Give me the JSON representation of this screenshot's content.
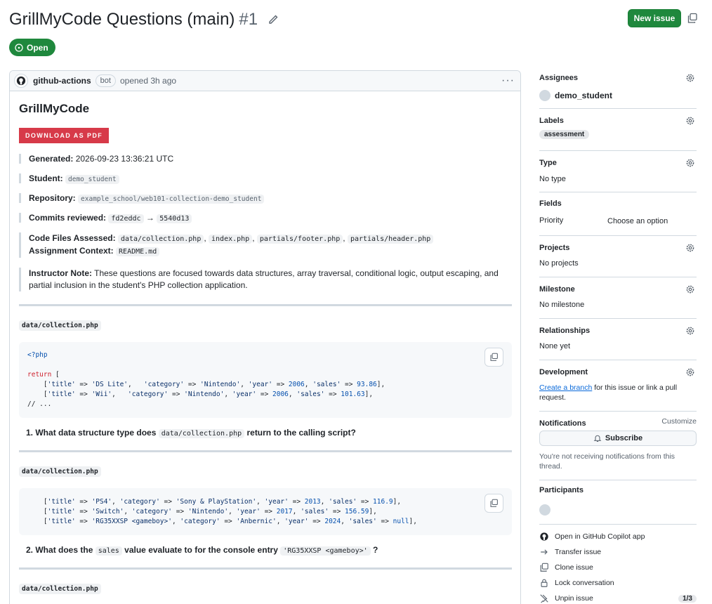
{
  "header": {
    "title": "GrillMyCode Questions (main)",
    "number": "#1",
    "new_issue_label": "New issue",
    "state": "Open"
  },
  "comment": {
    "author": "github-actions",
    "author_badge": "bot",
    "meta": "opened 3h ago",
    "heading": "GrillMyCode",
    "pdf_button": "DOWNLOAD AS PDF",
    "generated_label": "Generated:",
    "generated_value": "2026-09-23 13:36:21 UTC",
    "student_label": "Student:",
    "student_value": "demo_student",
    "repository_label": "Repository:",
    "repository_value": "example_school/web101-collection-demo_student",
    "commits_label": "Commits reviewed:",
    "commit_from": "fd2eddc",
    "commit_to": "5540d13",
    "code_files_label": "Code Files Assessed:",
    "code_files": [
      "data/collection.php",
      "index.php",
      "partials/footer.php",
      "partials/header.php"
    ],
    "context_label": "Assignment Context:",
    "context_value": "README.md",
    "note_label": "Instructor Note:",
    "note_line1": "These questions are focused towards data structures, array traversal, conditional logic, output escaping, and",
    "note_line2": "partial inclusion in the student's PHP collection application.",
    "sections": [
      {
        "file": "data/collection.php",
        "question_num": "1.",
        "q_pre": "What data structure type does",
        "q_code": "data/collection.php",
        "q_post": "return to the calling script?"
      },
      {
        "file": "data/collection.php",
        "question_num": "2.",
        "q_pre": "What does the",
        "q_code": "sales",
        "q_mid": "value evaluate to for the console entry",
        "q_code2": "'RG35XXSP <gameboy>'",
        "q_post": "?"
      },
      {
        "file": "data/collection.php"
      }
    ]
  },
  "sidebar": {
    "assignees_title": "Assignees",
    "assignee": "demo_student",
    "labels_title": "Labels",
    "label": "assessment",
    "type_title": "Type",
    "type_value": "No type",
    "fields_title": "Fields",
    "priority_label": "Priority",
    "priority_value": "Choose an option",
    "projects_title": "Projects",
    "projects_value": "No projects",
    "milestone_title": "Milestone",
    "milestone_value": "No milestone",
    "relationships_title": "Relationships",
    "relationships_value": "None yet",
    "development_title": "Development",
    "dev_link": "Create a branch",
    "dev_text1": "for this issue or link a pull",
    "dev_text2": "request.",
    "notifications_title": "Notifications",
    "customize": "Customize",
    "subscribe": "Subscribe",
    "notif_text1": "You're not receiving notifications from this",
    "notif_text2": "thread.",
    "participants_title": "Participants",
    "actions": [
      {
        "label": "Open in GitHub Copilot app",
        "icon": "github-icon"
      },
      {
        "label": "Transfer issue",
        "icon": "arrow-right-icon"
      },
      {
        "label": "Clone issue",
        "icon": "copy-icon"
      },
      {
        "label": "Lock conversation",
        "icon": "lock-icon"
      },
      {
        "label": "Unpin issue",
        "icon": "unpin-icon",
        "badge": "1/3"
      }
    ]
  },
  "colors": {
    "primary_green": "#1f883d",
    "pdf_red": "#d73a49",
    "link_blue": "#0969da"
  }
}
